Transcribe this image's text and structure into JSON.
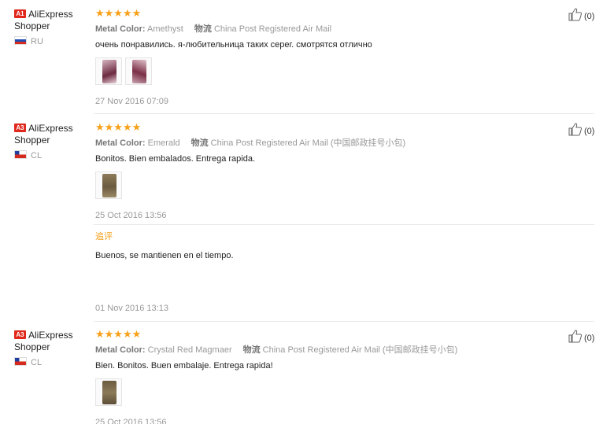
{
  "reviews": [
    {
      "badge": "A1",
      "buyer": "AliExpress Shopper",
      "country": "RU",
      "flag": "russia-flag",
      "stars": "★★★★★",
      "color_label": "Metal Color:",
      "color_value": "Amethyst",
      "shipping_label": "物流",
      "shipping_value": "China Post Registered Air Mail",
      "text": "очень понравились. я-любительница таких серег. смотрятся отлично",
      "images": [
        "earring-photo",
        "earring-photo"
      ],
      "date": "27 Nov 2016 07:09",
      "likes": "(0)"
    },
    {
      "badge": "A3",
      "buyer": "AliExpress Shopper",
      "country": "CL",
      "flag": "chile-flag",
      "stars": "★★★★★",
      "color_label": "Metal Color:",
      "color_value": "Emerald",
      "shipping_label": "物流",
      "shipping_value": "China Post Registered Air Mail (中国邮政挂号小包)",
      "text": "Bonitos. Bien embalados. Entrega rapida.",
      "images": [
        "earring-photo"
      ],
      "date": "25 Oct 2016 13:56",
      "additional_label": "追评",
      "additional_text": "Buenos, se mantienen en el tiempo.",
      "additional_date": "01 Nov 2016 13:13",
      "likes": "(0)"
    },
    {
      "badge": "A3",
      "buyer": "AliExpress Shopper",
      "country": "CL",
      "flag": "chile-flag",
      "stars": "★★★★★",
      "color_label": "Metal Color:",
      "color_value": "Crystal Red Magmaer",
      "shipping_label": "物流",
      "shipping_value": "China Post Registered Air Mail (中国邮政挂号小包)",
      "text": "Bien. Bonitos. Buen embalaje. Entrega rapida!",
      "images": [
        "earring-photo"
      ],
      "date": "25 Oct 2016 13:56",
      "likes": "(0)"
    }
  ],
  "colors": {
    "star": "#f7a11a",
    "badge": "#e0281c",
    "additional_label": "#f39c12"
  },
  "icons": {
    "like": "thumbs-up-icon"
  }
}
